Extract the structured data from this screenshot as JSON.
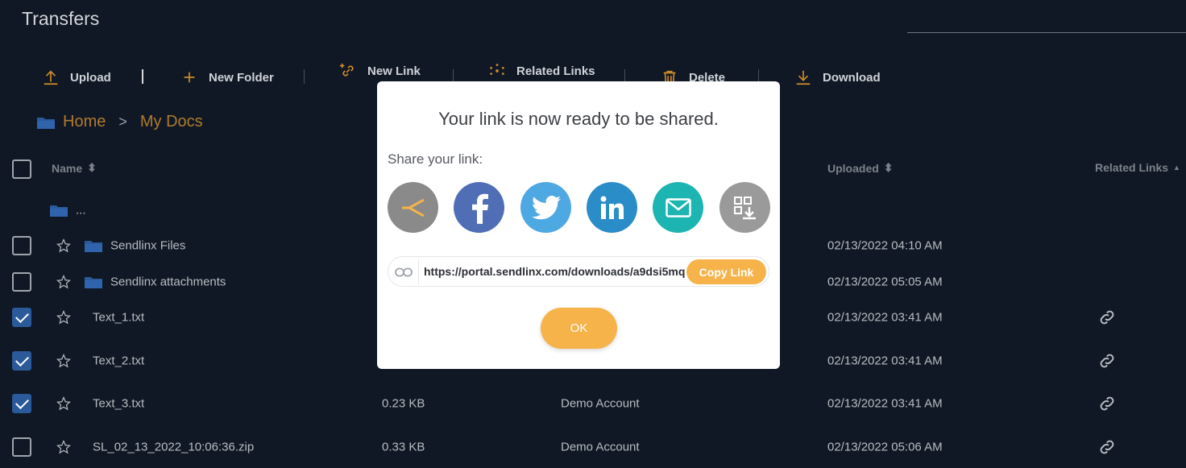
{
  "header": {
    "title": "Transfers"
  },
  "toolbar": {
    "upload": "Upload",
    "new_folder": "New Folder",
    "new_link": "New Link",
    "related_links": "Related Links",
    "delete": "Delete",
    "download": "Download"
  },
  "breadcrumb": {
    "home": "Home",
    "separator": ">",
    "current": "My Docs"
  },
  "table": {
    "headers": {
      "name": "Name",
      "uploaded": "Uploaded",
      "related_links": "Related Links"
    },
    "parent_row": "...",
    "rows": [
      {
        "name": "Sendlinx Files",
        "type": "folder",
        "size": "",
        "owner": "",
        "uploaded": "02/13/2022 04:10 AM",
        "checked": false,
        "has_link": false
      },
      {
        "name": "Sendlinx attachments",
        "type": "folder",
        "size": "",
        "owner": "",
        "uploaded": "02/13/2022 05:05 AM",
        "checked": false,
        "has_link": false
      },
      {
        "name": "Text_1.txt",
        "type": "file",
        "size": "",
        "owner": "",
        "uploaded": "02/13/2022 03:41 AM",
        "checked": true,
        "has_link": true
      },
      {
        "name": "Text_2.txt",
        "type": "file",
        "size": "",
        "owner": "",
        "uploaded": "02/13/2022 03:41 AM",
        "checked": true,
        "has_link": true
      },
      {
        "name": "Text_3.txt",
        "type": "file",
        "size": "0.23 KB",
        "owner": "Demo Account",
        "uploaded": "02/13/2022 03:41 AM",
        "checked": true,
        "has_link": true
      },
      {
        "name": "SL_02_13_2022_10:06:36.zip",
        "type": "file",
        "size": "0.33 KB",
        "owner": "Demo Account",
        "uploaded": "02/13/2022 05:06 AM",
        "checked": false,
        "has_link": true
      }
    ]
  },
  "modal": {
    "title": "Your link is now ready to be shared.",
    "share_label": "Share your link:",
    "share_icons": [
      "sendlinx-icon",
      "facebook-icon",
      "twitter-icon",
      "linkedin-icon",
      "email-icon",
      "qr-download-icon"
    ],
    "link_url": "https://portal.sendlinx.com/downloads/a9dsi5mq",
    "copy_label": "Copy Link",
    "ok_label": "OK"
  },
  "colors": {
    "accent": "#f6b34a",
    "breadcrumb": "#b07a2d",
    "facebook": "#4f6eb5",
    "twitter": "#4ea8e2",
    "linkedin": "#2a8dc8",
    "email": "#1db5b1",
    "sendlinx": "#8a8a8a",
    "qr": "#9a9a9a"
  }
}
